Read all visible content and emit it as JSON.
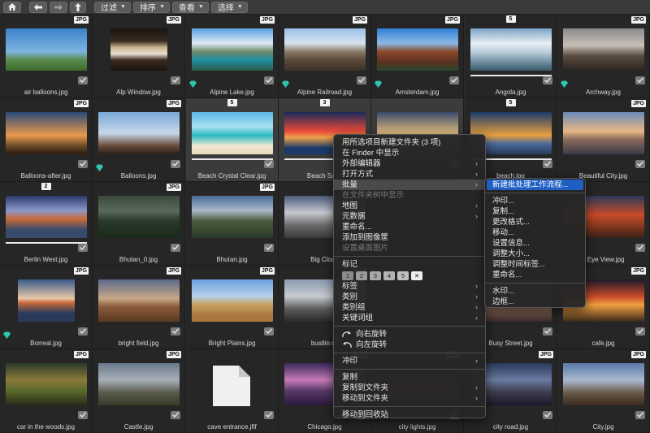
{
  "toolbar": {
    "filter_label": "过滤",
    "sort_label": "排序",
    "view_label": "查看",
    "select_label": "选择",
    "icons": [
      "home-icon",
      "back-arrow-icon",
      "forward-arrow-icon",
      "up-arrow-icon"
    ]
  },
  "grid": {
    "rows": [
      [
        {
          "name": "air balloons.jpg",
          "type": "JPG",
          "stack": "",
          "gem": false
        },
        {
          "name": "Alp Window.jpg",
          "type": "JPG",
          "stack": "",
          "gem": false
        },
        {
          "name": "Alpine Lake.jpg",
          "type": "JPG",
          "stack": "",
          "gem": true
        },
        {
          "name": "Alpine Railroad.jpg",
          "type": "JPG",
          "stack": "",
          "gem": true
        },
        {
          "name": "Amsterdam.jpg",
          "type": "JPG",
          "stack": "",
          "gem": true
        },
        {
          "name": "Angola.jpg",
          "type": "",
          "stack": "5",
          "gem": false
        },
        {
          "name": "Archway.jpg",
          "type": "JPG",
          "stack": "",
          "gem": true
        }
      ],
      [
        {
          "name": "Balloons-after.jpg",
          "type": "JPG",
          "stack": "",
          "gem": false
        },
        {
          "name": "Balloons.jpg",
          "type": "JPG",
          "stack": "",
          "gem": true
        },
        {
          "name": "Beach Crystal Clear.jpg",
          "type": "",
          "stack": "5",
          "gem": false
        },
        {
          "name": "Beach Suns",
          "type": "",
          "stack": "3",
          "gem": false
        },
        {
          "name": "",
          "type": "",
          "stack": "",
          "gem": false
        },
        {
          "name": "beach.jpg",
          "type": "",
          "stack": "5",
          "gem": false
        },
        {
          "name": "Beautiful City.jpg",
          "type": "JPG",
          "stack": "",
          "gem": false
        }
      ],
      [
        {
          "name": "Berlin West.jpg",
          "type": "",
          "stack": "2",
          "gem": false
        },
        {
          "name": "Bhutan_0.jpg",
          "type": "JPG",
          "stack": "",
          "gem": false
        },
        {
          "name": "Bhutan.jpg",
          "type": "JPG",
          "stack": "",
          "gem": false
        },
        {
          "name": "Big Cloud",
          "type": "JPG",
          "stack": "",
          "gem": false
        },
        {
          "name": "",
          "type": "",
          "stack": "",
          "gem": false
        },
        {
          "name": "",
          "type": "",
          "stack": "",
          "gem": false
        },
        {
          "name": "s Eye View.jpg",
          "type": "",
          "stack": "",
          "gem": false
        }
      ],
      [
        {
          "name": "Borreal.jpg",
          "type": "JPG",
          "stack": "",
          "gem": true
        },
        {
          "name": "bright field.jpg",
          "type": "JPG",
          "stack": "",
          "gem": false
        },
        {
          "name": "Bright Plains.jpg",
          "type": "JPG",
          "stack": "",
          "gem": false
        },
        {
          "name": "bustlin cit",
          "type": "JPG",
          "stack": "",
          "gem": false
        },
        {
          "name": "",
          "type": "",
          "stack": "",
          "gem": false
        },
        {
          "name": "Busy Street.jpg",
          "type": "",
          "stack": "",
          "gem": false
        },
        {
          "name": "cafe.jpg",
          "type": "JPG",
          "stack": "",
          "gem": false
        }
      ],
      [
        {
          "name": "car in the woods.jpg",
          "type": "JPG",
          "stack": "",
          "gem": false
        },
        {
          "name": "Castle.jpg",
          "type": "JPG",
          "stack": "",
          "gem": false
        },
        {
          "name": "cave entrance.jfif",
          "type": "",
          "stack": "",
          "gem": false
        },
        {
          "name": "Chicago.jpg",
          "type": "JPG",
          "stack": "",
          "gem": false
        },
        {
          "name": "city lights.jpg",
          "type": "JPG",
          "stack": "",
          "gem": false
        },
        {
          "name": "city road.jpg",
          "type": "JPG",
          "stack": "",
          "gem": false
        },
        {
          "name": "City.jpg",
          "type": "JPG",
          "stack": "",
          "gem": false
        }
      ]
    ]
  },
  "context_menu": {
    "new_folder": "用所选项目新建文件夹 (3 项)",
    "show_in_finder": "在 Finder 中显示",
    "external_editor": "外部编辑器",
    "open_with": "打开方式",
    "batch": "批量",
    "show_in_folder_tree": "在文件夹树中显示",
    "map": "地图",
    "metadata": "元数据",
    "rename": "重命名...",
    "add_to_basket": "添加到图像筐",
    "set_wallpaper": "设置桌面图片",
    "label_heading": "标记",
    "label_numbers": [
      "1",
      "2",
      "3",
      "4",
      "5",
      "✕"
    ],
    "tags": "标签",
    "category": "类别",
    "category_group": "类别组",
    "keyword_group": "关键词组",
    "rotate_right": "向右旋转",
    "rotate_left": "向左旋转",
    "watermark": "冲印",
    "copy": "复制",
    "copy_to_folder": "复制到文件夹",
    "move_to_folder": "移动到文件夹",
    "move_to_trash": "移动到回收站"
  },
  "submenu": {
    "new_batch_workflow": "新建批处理工作流程...",
    "print": "冲印...",
    "copy": "复制...",
    "change_format": "更改格式...",
    "move": "移动...",
    "set_info": "设置信息...",
    "resize": "调整大小...",
    "adjust_time": "调整时间标签...",
    "rename": "重命名...",
    "watermark": "水印...",
    "border": "边框..."
  },
  "colors": {
    "accent": "#1f5fc4",
    "gem": "#2fc6b0",
    "label_1": "#8a8a8a",
    "label_2": "#9a9a9a",
    "label_3": "#a8a8a8",
    "label_4": "#b4b4b4",
    "label_5": "#bfbfbf"
  }
}
